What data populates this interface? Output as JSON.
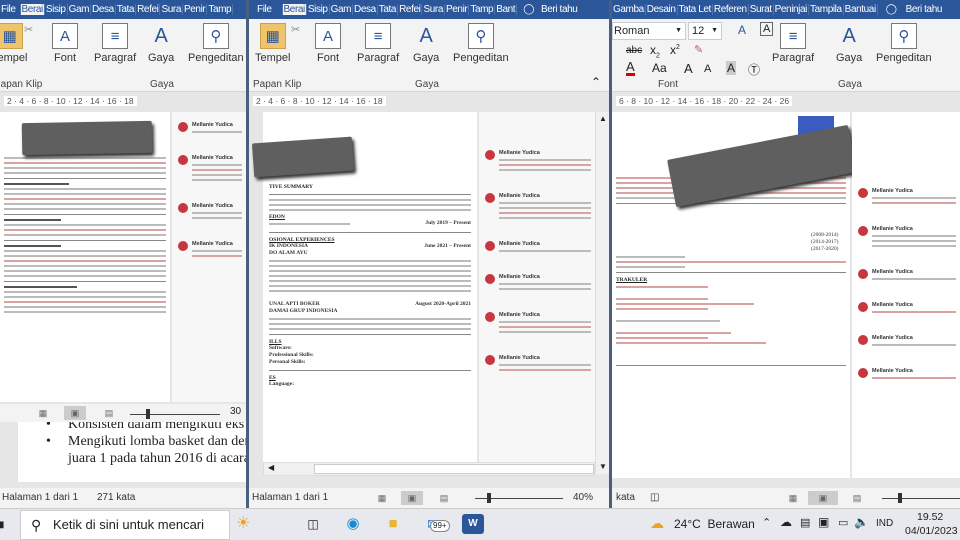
{
  "tabs_left": [
    "File",
    "Berai",
    "Sisip",
    "Gam",
    "Desa",
    "Tata",
    "Refei",
    "Sura",
    "Penir",
    "Tamp"
  ],
  "tabs_mid": [
    "File",
    "Berai",
    "Sisip",
    "Gam",
    "Desa",
    "Tata",
    "Refei",
    "Sura",
    "Penir",
    "Tamp",
    "Bant"
  ],
  "tabs_right": [
    "Gamba",
    "Desain",
    "Tata Let",
    "Referen",
    "Surat",
    "Peninjai",
    "Tampila",
    "Bantuai"
  ],
  "tell_me": "Beri tahu",
  "ribbon": {
    "paste": "Tempel",
    "clipboard": "Papan Klip",
    "font": "Font",
    "paragraph": "Paragraf",
    "styles": "Gaya",
    "styles_group": "Gaya",
    "editing": "Pengeditan",
    "font_name": "Roman",
    "font_size": "12"
  },
  "ruler_left": "2 · 4 · 6 · 8 · 10 · 12 · 14 · 16 · 18",
  "ruler_mid": "2 · 4 · 6 · 8 · 10 · 12 · 14 · 16 · 18",
  "ruler_right": "6 · 8 · 10 · 12 · 14 · 16 · 18 · 20 · 22 · 24 · 26",
  "middle_doc": {
    "summary": "TIVE SUMMARY",
    "edu": "EDON",
    "edu_date": "July 2019 – Present",
    "exp": "OSIONAL EXPERIENCES",
    "exp_company": "IK INDONESIA",
    "exp_role": "DO ALAM AYU",
    "exp_date": "June 2021 – Present",
    "exp2_company": "UNAL APTI BOKER",
    "exp2_org": "DAMAI GRUP INDONESIA",
    "exp2_date": "August 2020-April 2021",
    "skills": "ILLS",
    "software": "Software:",
    "professional": "Professional Skills:",
    "personal": "Personal Skills:",
    "lang_h": "ES",
    "language": "Language:"
  },
  "right_doc": {
    "dates": [
      "(2008-2014)",
      "(2014-2017)",
      "(2017-2020)"
    ],
    "extra": "TRAKULER"
  },
  "commenter": "Mellanie Yudica",
  "left_bg_doc": {
    "bullets": [
      "Konsisten dalam mengikuti eks",
      "Mengikuti lomba basket dan den",
      "juara 1 pada tahun 2016 di acara"
    ]
  },
  "status": {
    "left_page": "Halaman 1 dari 1",
    "left_words": "271 kata",
    "left_zoom": "30",
    "mid_page": "Halaman 1 dari 1",
    "mid_zoom": "40%",
    "right_words": "kata"
  },
  "taskbar": {
    "search_placeholder": "Ketik di sini untuk mencari",
    "mail_badge": "99+",
    "weather": "24°C  Berawan",
    "lang": "IND",
    "time": "19.52",
    "date": "04/01/2023"
  }
}
